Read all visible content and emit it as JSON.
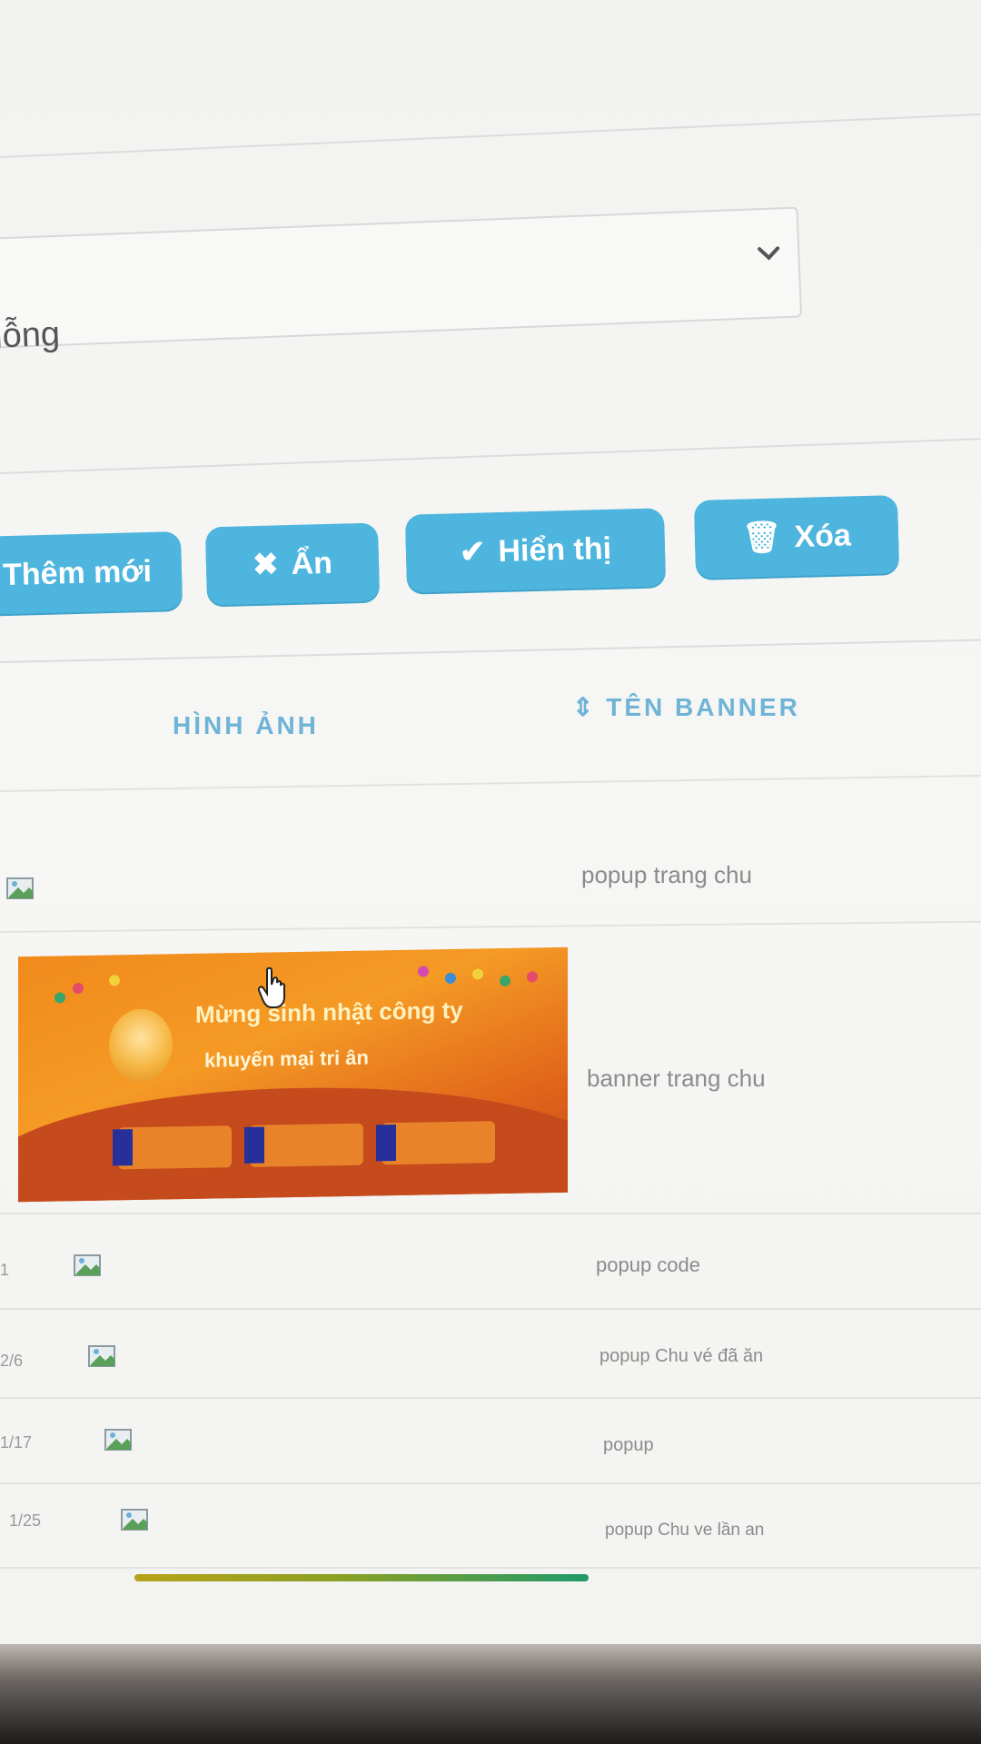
{
  "form": {
    "status_select": {
      "value": "lỗng"
    }
  },
  "toolbar": {
    "add_label": "Thêm mới",
    "hide_label": "Ẩn",
    "show_label": "Hiển thị",
    "delete_label": "Xóa"
  },
  "table": {
    "columns": {
      "image": "HÌNH ẢNH",
      "name": "TÊN BANNER"
    },
    "rows": [
      {
        "name": "popup trang chu"
      },
      {
        "name": "banner trang chu"
      },
      {
        "num": "1",
        "name": "popup code"
      },
      {
        "num": "2/6",
        "name": "popup Chu vé đã ăn"
      },
      {
        "num": "1/17",
        "name": "popup"
      },
      {
        "num": "1/25",
        "name": "popup Chu ve lần an"
      }
    ]
  },
  "banner_image": {
    "headline": "Mừng sinh nhật công ty",
    "subline": "khuyến mại tri ân"
  },
  "colors": {
    "button": "#4db5de",
    "header_text": "#6fb3d6"
  }
}
